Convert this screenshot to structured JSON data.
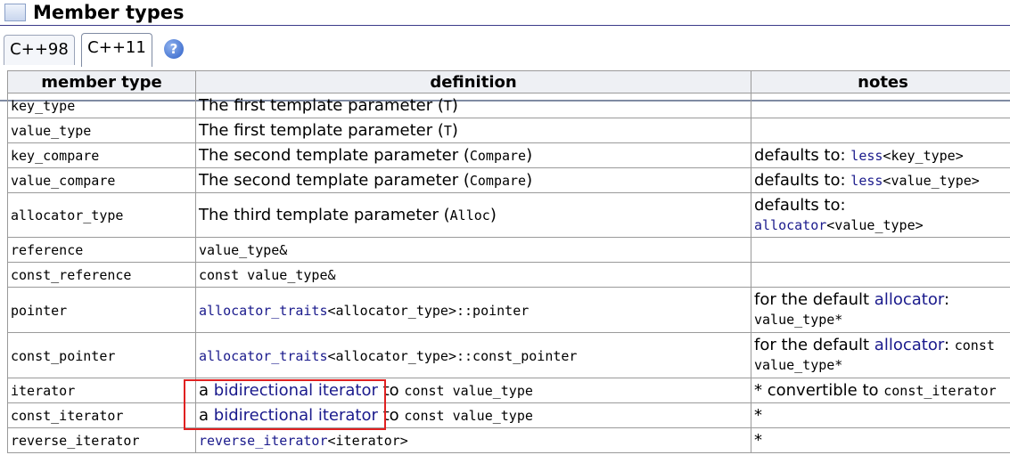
{
  "header": {
    "title": "Member types"
  },
  "tabs": [
    {
      "label": "C++98",
      "active": false
    },
    {
      "label": "C++11",
      "active": true
    }
  ],
  "help": {
    "label": "?"
  },
  "table": {
    "columns": [
      "member type",
      "definition",
      "notes"
    ],
    "rows": {
      "key_type": {
        "name": "key_type",
        "def": "The first template parameter (",
        "def_code": "T",
        "def_end": ")"
      },
      "value_type": {
        "name": "value_type",
        "def": "The first template parameter (",
        "def_code": "T",
        "def_end": ")"
      },
      "key_compare": {
        "name": "key_compare",
        "def": "The second template parameter (",
        "def_code": "Compare",
        "def_end": ")",
        "note": "defaults to: ",
        "note_link": "less",
        "note_code": "<key_type>"
      },
      "value_compare": {
        "name": "value_compare",
        "def": "The second template parameter (",
        "def_code": "Compare",
        "def_end": ")",
        "note": "defaults to: ",
        "note_link": "less",
        "note_code": "<value_type>"
      },
      "allocator_type": {
        "name": "allocator_type",
        "def": "The third template parameter (",
        "def_code": "Alloc",
        "def_end": ")",
        "note": "defaults to:",
        "note_link": "allocator",
        "note_code": "<value_type>"
      },
      "reference": {
        "name": "reference",
        "def_code": "value_type&"
      },
      "const_reference": {
        "name": "const_reference",
        "def_code": "const value_type&"
      },
      "pointer": {
        "name": "pointer",
        "def_link": "allocator_traits",
        "def_code": "<allocator_type>::pointer",
        "note": "for the default ",
        "note_link": "allocator",
        "note_end": ":",
        "note_code2": "value_type*"
      },
      "const_pointer": {
        "name": "const_pointer",
        "def_link": "allocator_traits",
        "def_code": "<allocator_type>::const_pointer",
        "note": "for the default ",
        "note_link": "allocator",
        "note_end": ": ",
        "note_code": "const",
        "note_code2": "value_type*"
      },
      "iterator": {
        "name": "iterator",
        "def_a": "a ",
        "def_link": "bidirectional iterator",
        "def_to": " to ",
        "def_code": "const value_type",
        "note": "* convertible to ",
        "note_code": "const_iterator"
      },
      "const_iterator": {
        "name": "const_iterator",
        "def_a": "a ",
        "def_link": "bidirectional iterator",
        "def_to": " to ",
        "def_code": "const value_type",
        "note": "*"
      },
      "reverse_iterator": {
        "name": "reverse_iterator",
        "def_link": "reverse_iterator",
        "def_code": "<iterator>",
        "note": "*"
      }
    }
  },
  "colors": {
    "link": "#1a1a8c",
    "highlight": "#e02020",
    "header_rule": "#3a3a8a"
  }
}
